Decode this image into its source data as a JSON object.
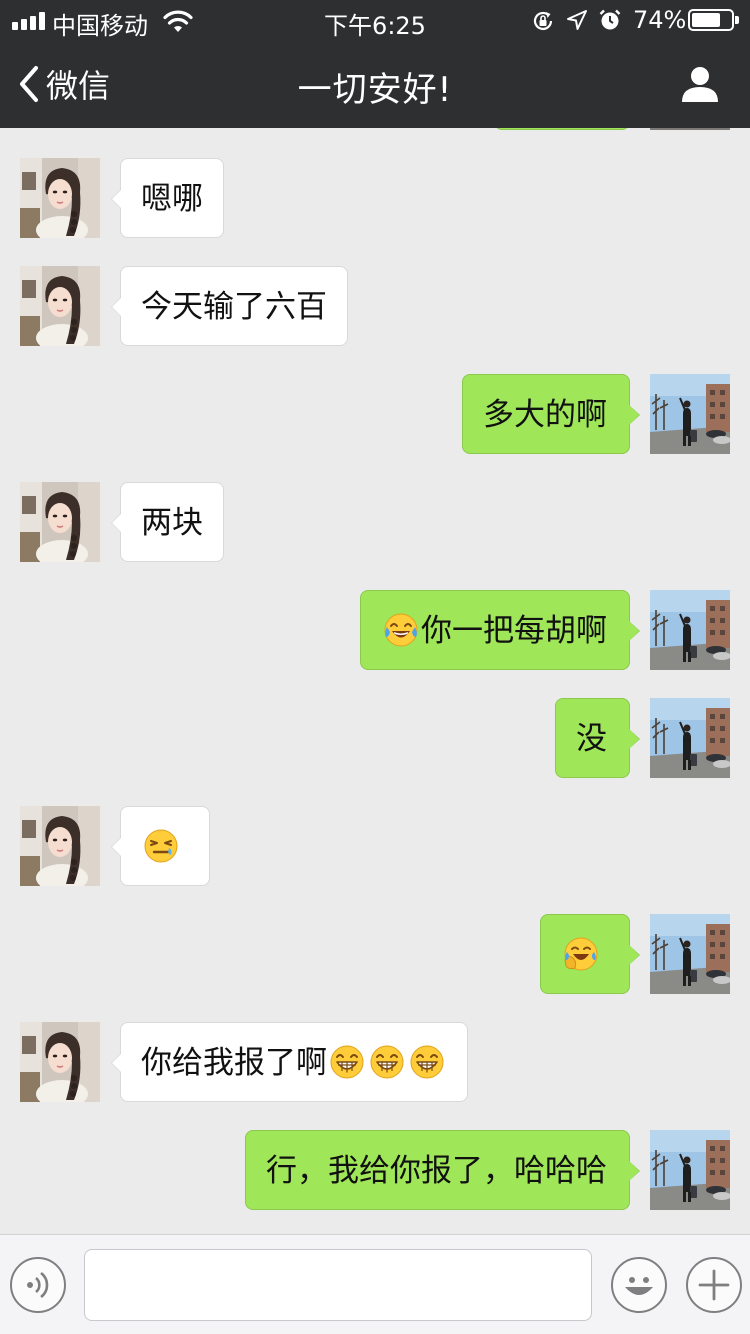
{
  "status_bar": {
    "carrier": "中国移动",
    "time": "下午6:25",
    "battery_percent": "74%",
    "battery_level": 0.74,
    "icons": [
      "signal-icon",
      "wifi-icon",
      "orientation-lock-icon",
      "location-icon",
      "alarm-icon",
      "battery-icon"
    ]
  },
  "nav": {
    "back_label": "微信",
    "title": "一切安好!",
    "icons": [
      "chevron-left-icon",
      "profile-icon"
    ]
  },
  "colors": {
    "nav_bg": "#2e2f31",
    "chat_bg": "#ebebeb",
    "outgoing_bubble": "#9fe658",
    "incoming_bubble": "#ffffff"
  },
  "messages": [
    {
      "side": "left",
      "text": "嗯哪",
      "emoji": []
    },
    {
      "side": "left",
      "text": "今天输了六百",
      "emoji": []
    },
    {
      "side": "right",
      "text": "多大的啊",
      "emoji": []
    },
    {
      "side": "left",
      "text": "两块",
      "emoji": []
    },
    {
      "side": "right",
      "text": "你一把每胡啊",
      "emoji": [
        "tears-of-joy-emoji"
      ]
    },
    {
      "side": "right",
      "text": "没",
      "emoji": []
    },
    {
      "side": "left",
      "text": "",
      "emoji": [
        "embarrassed-emoji"
      ]
    },
    {
      "side": "right",
      "text": "",
      "emoji": [
        "facepalm-laugh-emoji"
      ]
    },
    {
      "side": "left",
      "text": "你给我报了啊",
      "emoji": [
        "grin-emoji",
        "grin-emoji",
        "grin-emoji"
      ]
    },
    {
      "side": "right",
      "text": "行，我给你报了，哈哈哈",
      "emoji": []
    }
  ],
  "input_bar": {
    "placeholder": "",
    "icons": [
      "voice-icon",
      "emoji-icon",
      "plus-icon"
    ]
  }
}
